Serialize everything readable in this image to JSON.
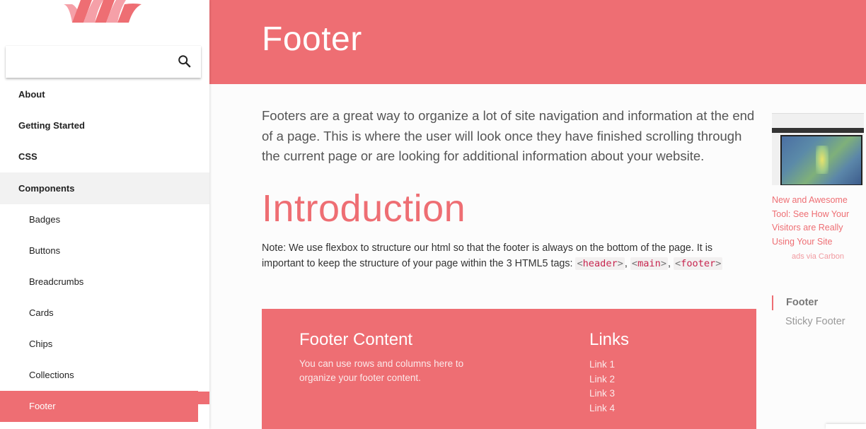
{
  "brand": {
    "logo": "materialize-logo",
    "accent": "#ee6e73"
  },
  "search": {
    "placeholder": "",
    "value": ""
  },
  "sidebar": {
    "items": [
      {
        "label": "About",
        "level": "top"
      },
      {
        "label": "Getting Started",
        "level": "top"
      },
      {
        "label": "CSS",
        "level": "top"
      },
      {
        "label": "Components",
        "level": "top",
        "expanded": true
      },
      {
        "label": "Badges",
        "level": "sub"
      },
      {
        "label": "Buttons",
        "level": "sub"
      },
      {
        "label": "Breadcrumbs",
        "level": "sub"
      },
      {
        "label": "Cards",
        "level": "sub"
      },
      {
        "label": "Chips",
        "level": "sub"
      },
      {
        "label": "Collections",
        "level": "sub"
      },
      {
        "label": "Footer",
        "level": "sub",
        "active": true
      }
    ]
  },
  "header": {
    "title": "Footer"
  },
  "main": {
    "intro": "Footers are a great way to organize a lot of site navigation and information at the end of a page. This is where the user will look once they have finished scrolling through the current page or are looking for additional information about your website.",
    "section_title": "Introduction",
    "note_text": "Note: We use flexbox to structure our html so that the footer is always on the bottom of the page. It is important to keep the structure of your page within the 3 HTML5 tags: ",
    "tags": [
      "header",
      "main",
      "footer"
    ],
    "separator": ", "
  },
  "demo_footer": {
    "content_title": "Footer Content",
    "content_text": "You can use rows and columns here to organize your footer content.",
    "links_title": "Links",
    "links": [
      "Link 1",
      "Link 2",
      "Link 3",
      "Link 4"
    ]
  },
  "ad": {
    "image": "hotjar-heatmap-screenshot",
    "text": "New and Awesome Tool: See How Your Visitors are Really Using Your Site",
    "via": "ads via Carbon"
  },
  "toc": {
    "items": [
      {
        "label": "Footer",
        "active": true
      },
      {
        "label": "Sticky Footer",
        "active": false
      }
    ]
  }
}
